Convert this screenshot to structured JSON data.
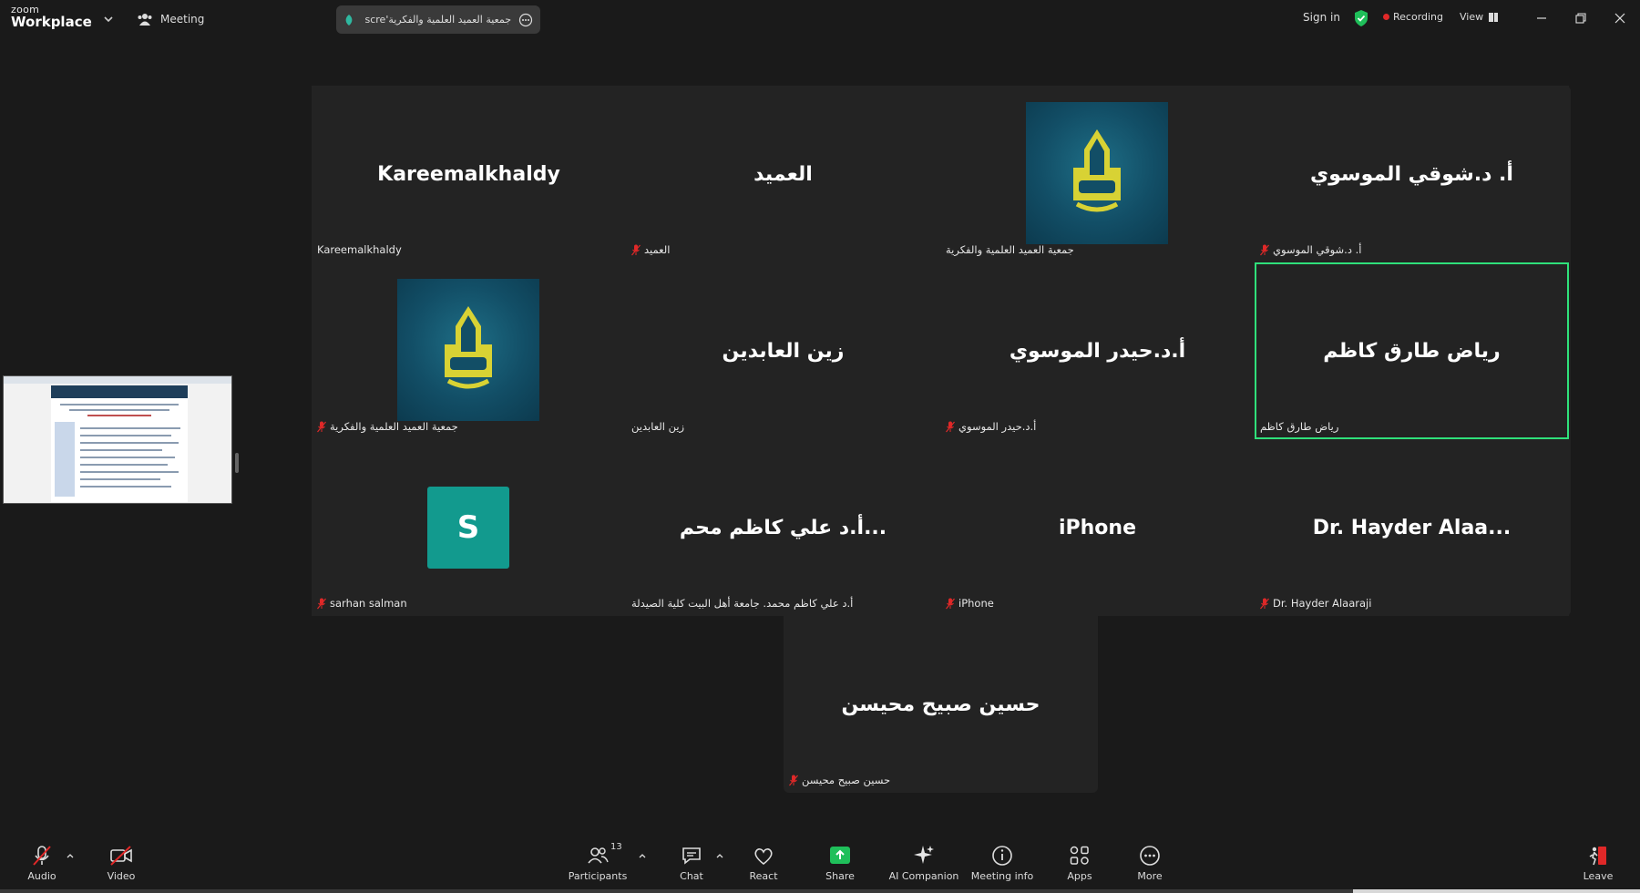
{
  "titlebar": {
    "logo_small": "zoom",
    "logo_main": "Workplace",
    "meeting_label": "Meeting",
    "share_pill_text": "جمعية العميد العلمية والفكرية's scre",
    "sign_in": "Sign in",
    "recording": "Recording",
    "view": "View"
  },
  "gallery": {
    "tiles": [
      {
        "big": "Kareemalkhaldy",
        "label": "Kareemalkhaldy",
        "muted": false,
        "avatar": "none"
      },
      {
        "big": "العميد",
        "label": "العميد",
        "muted": true,
        "avatar": "none"
      },
      {
        "big": "",
        "label": "جمعية العميد العلمية والفكرية",
        "muted": false,
        "avatar": "logo"
      },
      {
        "big": "أ. د.شوقي الموسوي",
        "label": "أ. د.شوقي الموسوي",
        "muted": true,
        "avatar": "none"
      },
      {
        "big": "",
        "label": "جمعية العميد العلمية والفكرية",
        "muted": true,
        "avatar": "logo"
      },
      {
        "big": "زين العابدين",
        "label": "زين العابدين",
        "muted": false,
        "avatar": "none"
      },
      {
        "big": "أ.د.حيدر الموسوي",
        "label": "أ.د.حيدر الموسوي",
        "muted": true,
        "avatar": "none"
      },
      {
        "big": "رياض طارق كاظم",
        "label": "رياض طارق كاظم",
        "muted": false,
        "avatar": "none",
        "active": true
      },
      {
        "big": "",
        "label": "sarhan salman",
        "muted": true,
        "avatar": "letter",
        "letter": "S"
      },
      {
        "big": "أ.د علي كاظم محم...",
        "label": "أ.د علي كاظم محمد. جامعة أهل البيت كلية الصيدلة",
        "muted": false,
        "avatar": "none"
      },
      {
        "big": "iPhone",
        "label": "iPhone",
        "muted": true,
        "avatar": "none"
      },
      {
        "big": "Dr. Hayder Alaa...",
        "label": "Dr. Hayder Alaaraji",
        "muted": true,
        "avatar": "none"
      }
    ],
    "lone_tile": {
      "big": "حسين صبيح محيسن",
      "label": "حسين صبيح محيسن",
      "muted": true
    }
  },
  "toolbar": {
    "audio": "Audio",
    "video": "Video",
    "participants": "Participants",
    "participants_count": "13",
    "chat": "Chat",
    "react": "React",
    "share": "Share",
    "ai_companion": "AI Companion",
    "meeting_info": "Meeting info",
    "apps": "Apps",
    "more": "More",
    "leave": "Leave"
  },
  "colors": {
    "active_border": "#2fe07a",
    "share_green": "#1fbf5a",
    "mute_red": "#e02828",
    "tile_bg": "#232323",
    "logo_teal": "#124e66",
    "logo_gold": "#d8d234"
  }
}
